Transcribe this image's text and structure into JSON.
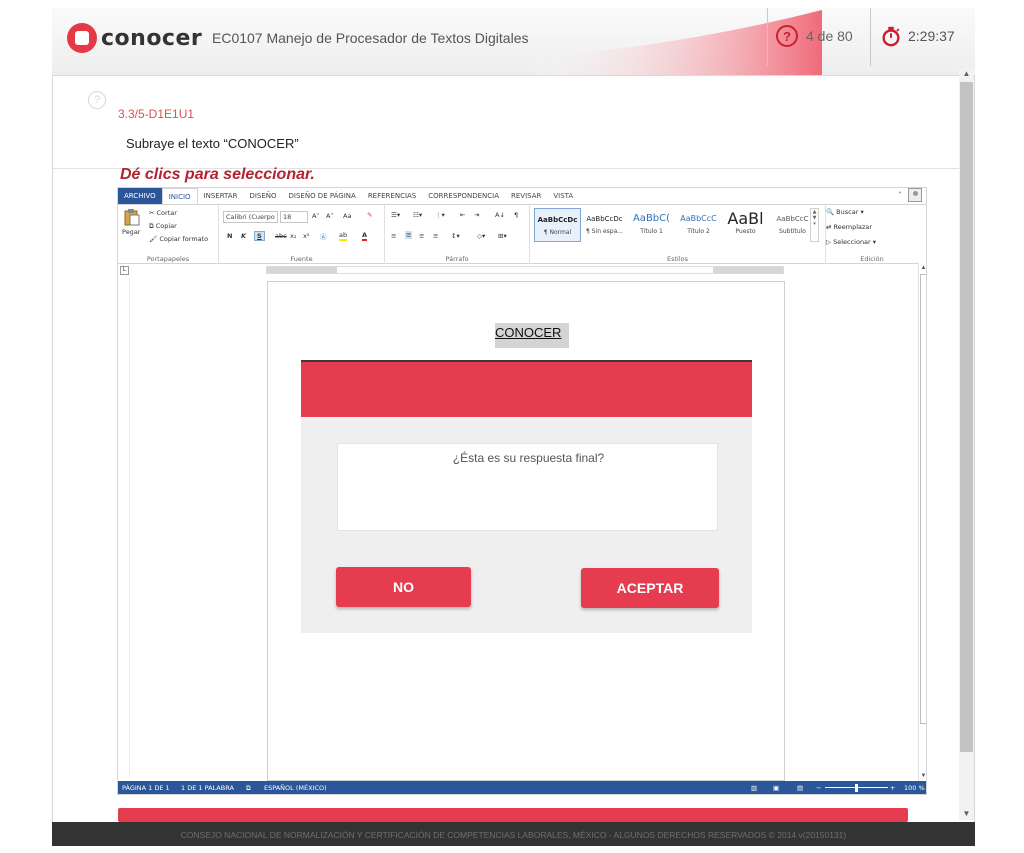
{
  "header": {
    "logo_text": "conocer",
    "exam_title": "EC0107 Manejo de Procesador de Textos Digitales",
    "question_counter": "4 de 80",
    "timer": "2:29:37",
    "accent_color": "#e63c4f"
  },
  "question": {
    "help_icon": "?",
    "id": "3.3/5-D1E1U1",
    "prompt": "Subraye el texto “CONOCER”",
    "instruction": "Dé clics para seleccionar."
  },
  "word": {
    "tabs": [
      "ARCHIVO",
      "INICIO",
      "INSERTAR",
      "DISEÑO",
      "DISEÑO DE PÁGINA",
      "REFERENCIAS",
      "CORRESPONDENCIA",
      "REVISAR",
      "VISTA"
    ],
    "active_tab": "INICIO",
    "clipboard": {
      "paste": "Pegar",
      "cut": "Cortar",
      "copy": "Copiar",
      "format_painter": "Copiar formato",
      "group": "Portapapeles"
    },
    "font": {
      "name": "Calibri (Cuerpo",
      "size": "18",
      "group": "Fuente",
      "bold": "N",
      "italic": "K",
      "underline": "S",
      "strike": "abc",
      "sub": "x₂",
      "sup": "x²",
      "grow": "A˄",
      "shrink": "A˅",
      "case": "Aa"
    },
    "paragraph": {
      "group": "Párrafo",
      "pilcrow": "¶",
      "sort": "A↓"
    },
    "styles": {
      "group": "Estilos",
      "items": [
        {
          "preview": "AaBbCcDc",
          "name": "¶ Normal"
        },
        {
          "preview": "AaBbCcDc",
          "name": "¶ Sin espa..."
        },
        {
          "preview": "AaBbC(",
          "name": "Título 1"
        },
        {
          "preview": "AaBbCcC",
          "name": "Título 2"
        },
        {
          "preview": "AaBl",
          "name": "Puesto"
        },
        {
          "preview": "AaBbCcC",
          "name": "Subtítulo"
        }
      ]
    },
    "editing": {
      "find": "Buscar",
      "replace": "Reemplazar",
      "select": "Seleccionar",
      "group": "Edición"
    },
    "document_text": "CONOCER",
    "status": {
      "page": "PÁGINA 1 DE 1",
      "words": "1 DE 1 PALABRA",
      "language": "ESPAÑOL (MÉXICO)",
      "zoom": "100 %"
    }
  },
  "dialog": {
    "message": "¿Ésta es su respuesta final?",
    "no_label": "NO",
    "accept_label": "ACEPTAR"
  },
  "footer": {
    "text": "CONSEJO NACIONAL DE NORMALIZACIÓN Y CERTIFICACIÓN DE COMPETENCIAS LABORALES, MÉXICO - ALGUNOS DERECHOS RESERVADOS © 2014 v(20150131)"
  }
}
